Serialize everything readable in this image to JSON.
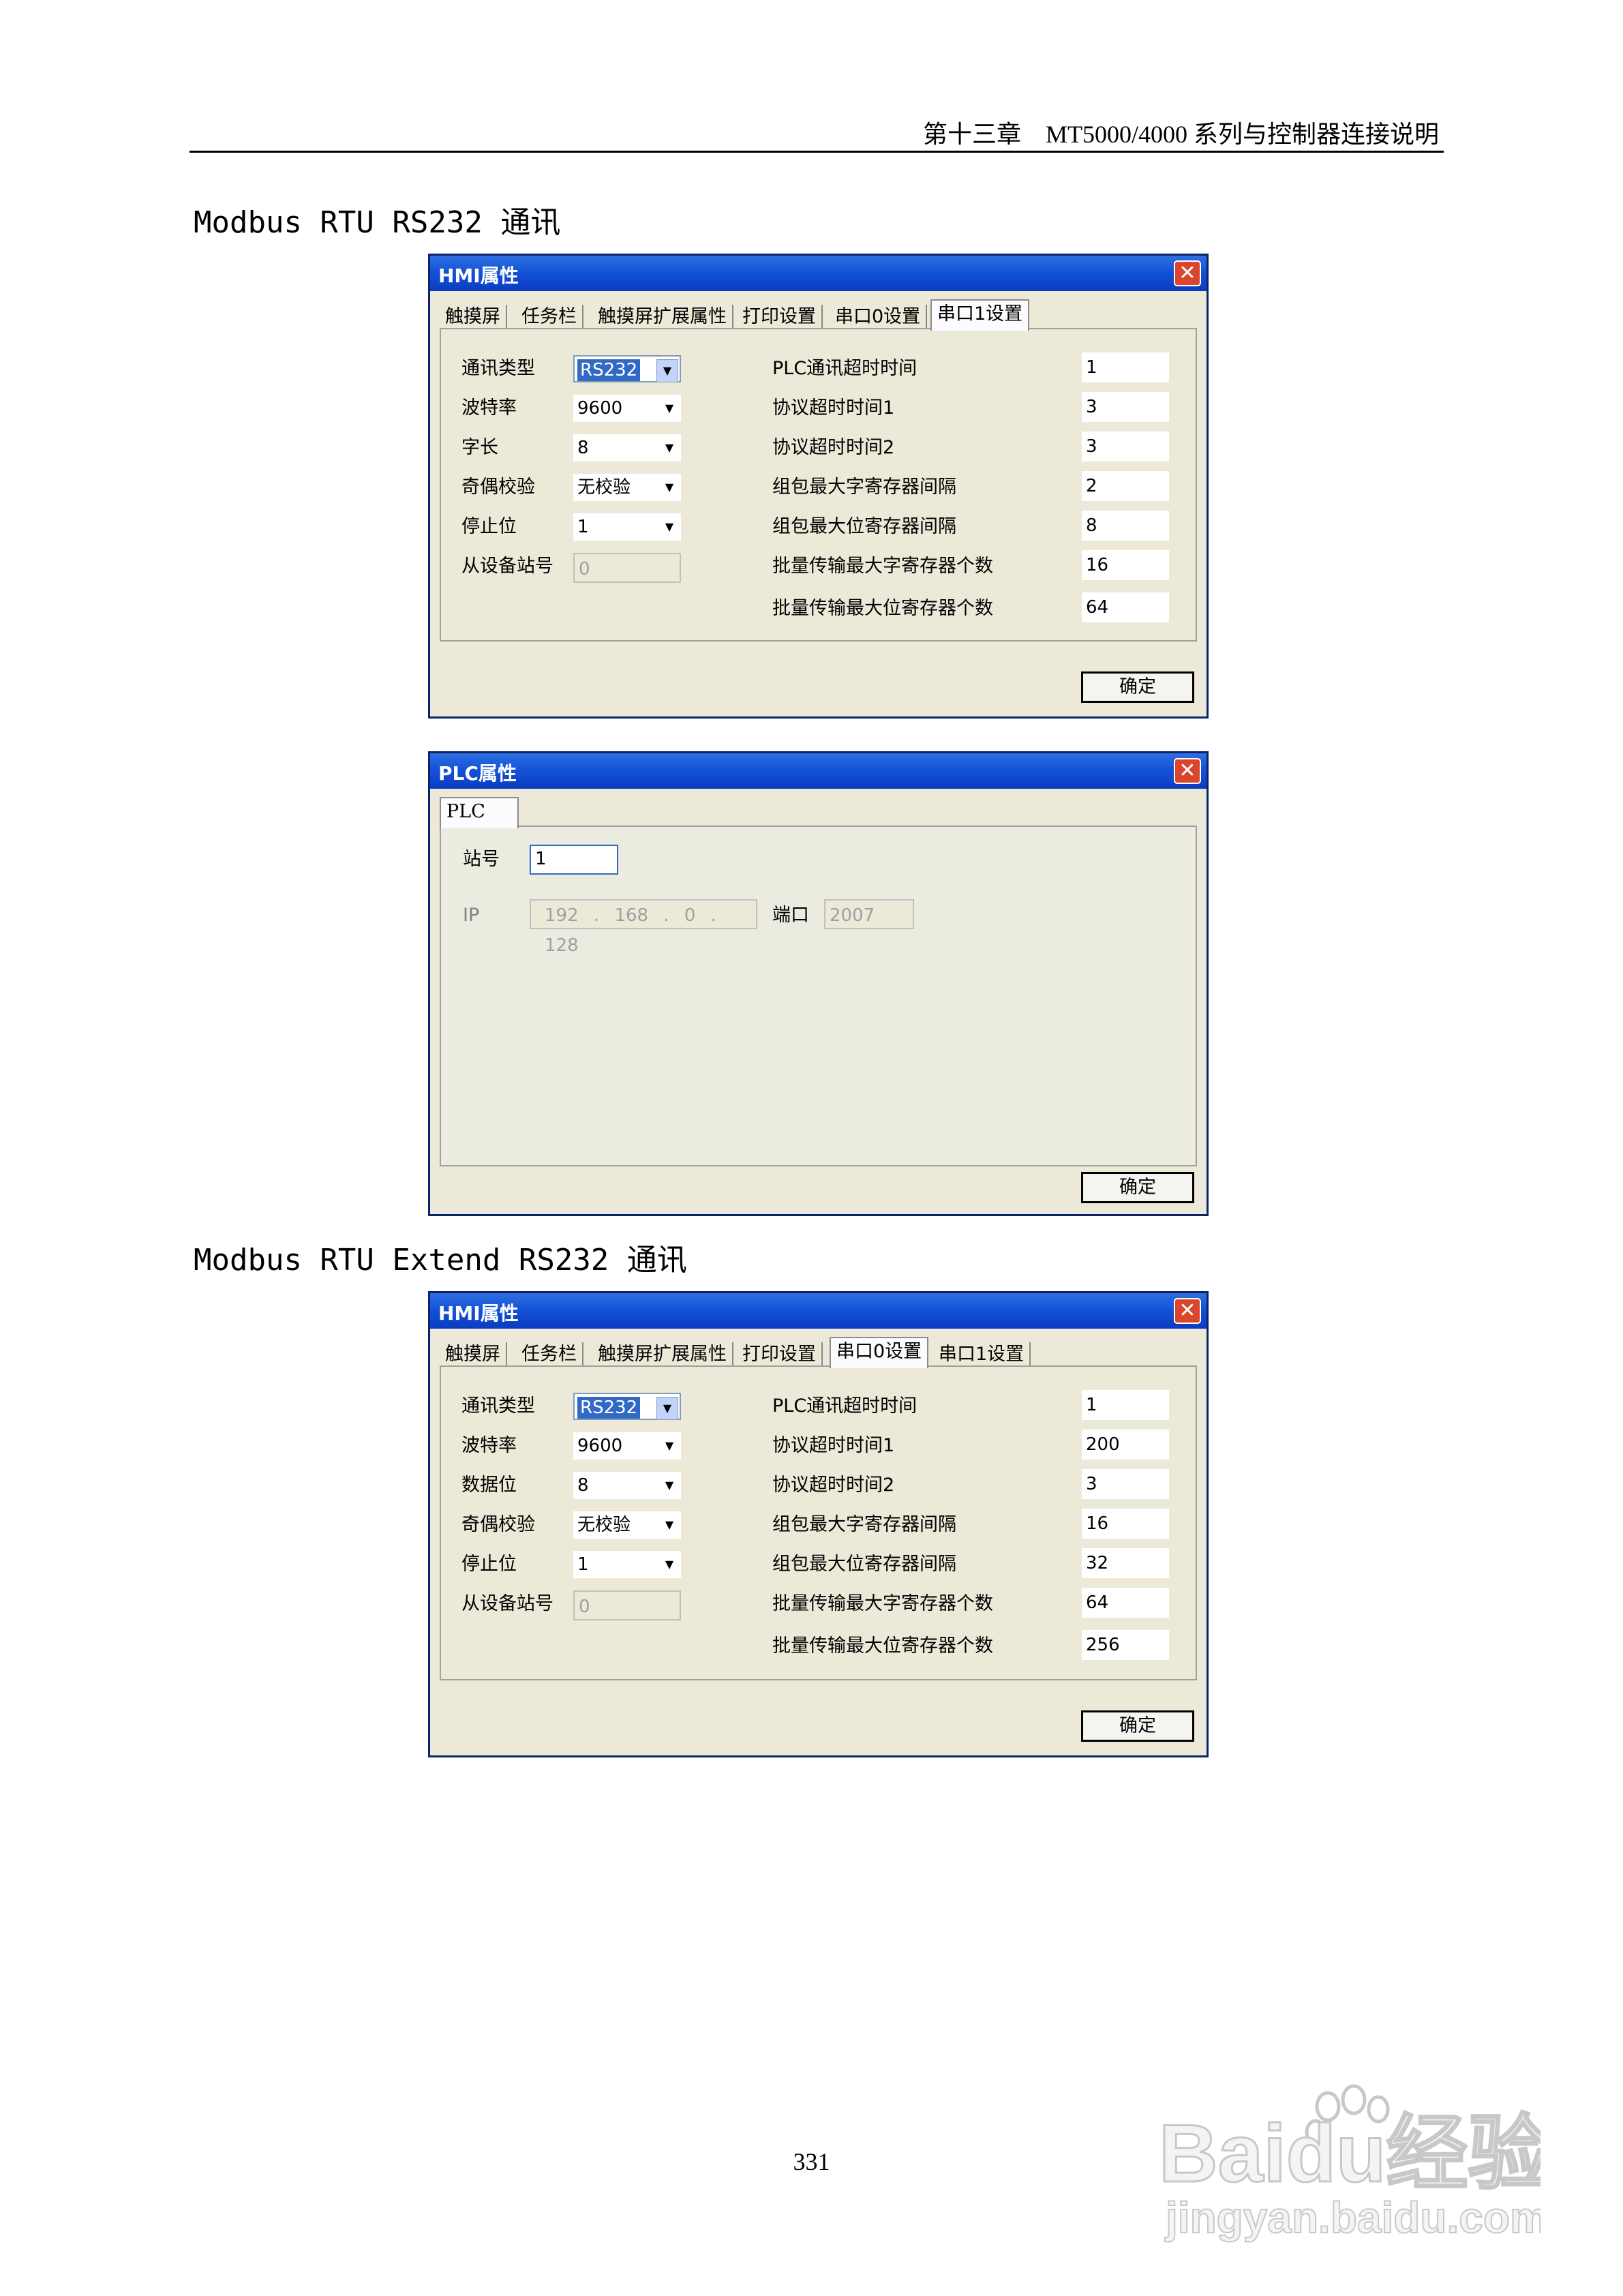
{
  "header": {
    "text": "第十三章　MT5000/4000 系列与控制器连接说明"
  },
  "sections": [
    {
      "title": "Modbus RTU RS232 通讯"
    },
    {
      "title": "Modbus RTU Extend RS232 通讯"
    }
  ],
  "dialog1": {
    "title": "HMI属性",
    "tabs": [
      "触摸屏",
      "任务栏",
      "触摸屏扩展属性",
      "打印设置",
      "串口0设置",
      "串口1设置"
    ],
    "active_tab": "串口1设置",
    "left": [
      {
        "label": "通讯类型",
        "value": "RS232"
      },
      {
        "label": "波特率",
        "value": "9600"
      },
      {
        "label": "字长",
        "value": "8"
      },
      {
        "label": "奇偶校验",
        "value": "无校验"
      },
      {
        "label": "停止位",
        "value": "1"
      },
      {
        "label": "从设备站号",
        "value": "0"
      }
    ],
    "right": [
      {
        "label": "PLC通讯超时时间",
        "value": "1"
      },
      {
        "label": "协议超时时间1",
        "value": "3"
      },
      {
        "label": "协议超时时间2",
        "value": "3"
      },
      {
        "label": "组包最大字寄存器间隔",
        "value": "2"
      },
      {
        "label": "组包最大位寄存器间隔",
        "value": "8"
      },
      {
        "label": "批量传输最大字寄存器个数",
        "value": "16"
      },
      {
        "label": "批量传输最大位寄存器个数",
        "value": "64"
      }
    ],
    "ok": "确定"
  },
  "dialog2": {
    "title": "PLC属性",
    "tab": "PLC",
    "station_label": "站号",
    "station_value": "1",
    "ip_label": "IP",
    "ip": [
      "192",
      "168",
      "0",
      "128"
    ],
    "port_label": "端口",
    "port_value": "2007",
    "ok": "确定"
  },
  "dialog3": {
    "title": "HMI属性",
    "tabs": [
      "触摸屏",
      "任务栏",
      "触摸屏扩展属性",
      "打印设置",
      "串口0设置",
      "串口1设置"
    ],
    "active_tab": "串口0设置",
    "left": [
      {
        "label": "通讯类型",
        "value": "RS232"
      },
      {
        "label": "波特率",
        "value": "9600"
      },
      {
        "label": "数据位",
        "value": "8"
      },
      {
        "label": "奇偶校验",
        "value": "无校验"
      },
      {
        "label": "停止位",
        "value": "1"
      },
      {
        "label": "从设备站号",
        "value": "0"
      }
    ],
    "right": [
      {
        "label": "PLC通讯超时时间",
        "value": "1"
      },
      {
        "label": "协议超时时间1",
        "value": "200"
      },
      {
        "label": "协议超时时间2",
        "value": "3"
      },
      {
        "label": "组包最大字寄存器间隔",
        "value": "16"
      },
      {
        "label": "组包最大位寄存器间隔",
        "value": "32"
      },
      {
        "label": "批量传输最大字寄存器个数",
        "value": "64"
      },
      {
        "label": "批量传输最大位寄存器个数",
        "value": "256"
      }
    ],
    "ok": "确定"
  },
  "page_number": "331",
  "watermark": {
    "line1": "Baidu经验",
    "line2": "jingyan.baidu.com"
  }
}
